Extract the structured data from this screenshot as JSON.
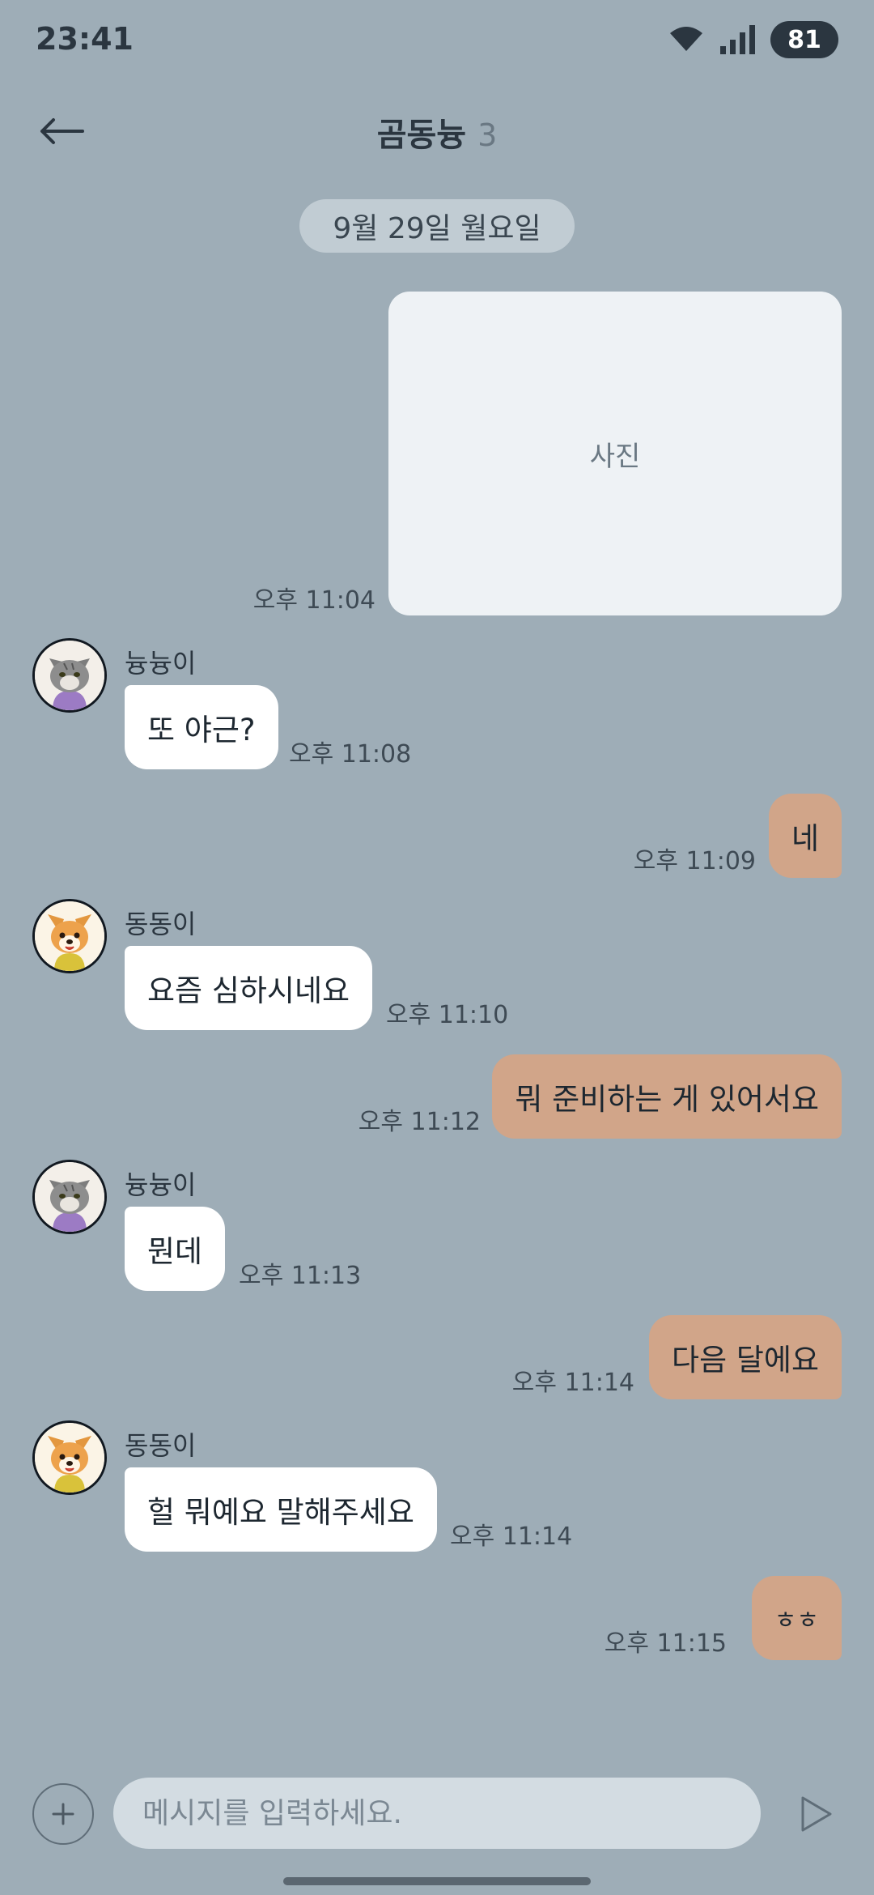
{
  "status": {
    "time": "23:41",
    "battery": "81"
  },
  "header": {
    "title": "곰동늉",
    "member_count": "3",
    "back_label": "←"
  },
  "date_label": "9월 29일 월요일",
  "photo": {
    "label": "사진",
    "time": "오후 11:04"
  },
  "messages": [
    {
      "sender": "늉늉이",
      "text": "또 야근?",
      "time": "오후 11:08"
    },
    {
      "text": "네",
      "time": "오후 11:09"
    },
    {
      "sender": "동동이",
      "text": "요즘 심하시네요",
      "time": "오후 11:10"
    },
    {
      "text": "뭐 준비하는 게 있어서요",
      "time": "오후 11:12"
    },
    {
      "sender": "늉늉이",
      "text": "뭔데",
      "time": "오후 11:13"
    },
    {
      "text": "다음 달에요",
      "time": "오후 11:14"
    },
    {
      "sender": "동동이",
      "text": "헐 뭐예요 말해주세요",
      "time": "오후 11:14"
    },
    {
      "text": "ㅎㅎ",
      "time": "오후 11:15"
    }
  ],
  "composer": {
    "placeholder": "메시지를 입력하세요."
  },
  "colors": {
    "background": "#9eadb7",
    "outgoing_bubble": "#d1a589",
    "incoming_bubble": "#ffffff"
  }
}
